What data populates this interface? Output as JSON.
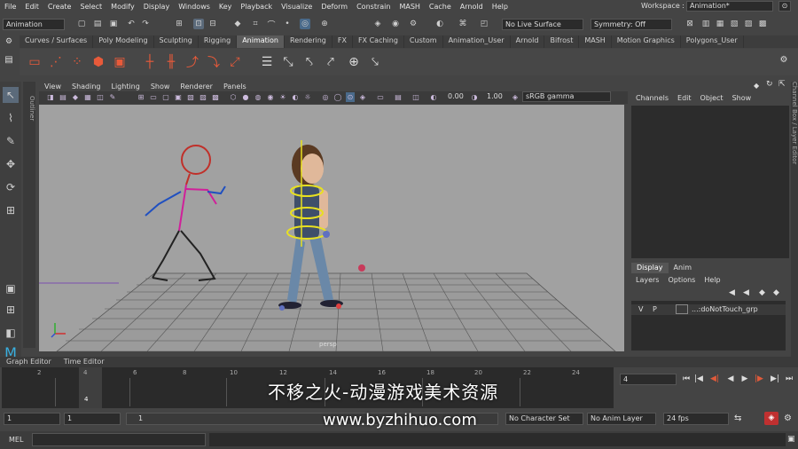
{
  "menubar": {
    "items": [
      "File",
      "Edit",
      "Create",
      "Select",
      "Modify",
      "Display",
      "Windows",
      "Key",
      "Playback",
      "Visualize",
      "Deform",
      "Constrain",
      "MASH",
      "Cache",
      "Arnold",
      "Help"
    ],
    "workspace_label": "Workspace :",
    "workspace_value": "Animation*"
  },
  "statusline": {
    "mode": "Animation",
    "live_surface": "No Live Surface",
    "symmetry": "Symmetry: Off"
  },
  "shelf_tabs": [
    "Curves / Surfaces",
    "Poly Modeling",
    "Sculpting",
    "Rigging",
    "Animation",
    "Rendering",
    "FX",
    "FX Caching",
    "Custom",
    "Animation_User",
    "Arnold",
    "Bifrost",
    "MASH",
    "Motion Graphics",
    "Polygons_User"
  ],
  "active_shelf_tab": "Animation",
  "outliner_label": "Outliner",
  "panel_menu": [
    "View",
    "Shading",
    "Lighting",
    "Show",
    "Renderer",
    "Panels"
  ],
  "panel_toolbar": {
    "exposure": "0.00",
    "gamma": "1.00",
    "color_space": "sRGB gamma"
  },
  "viewport": {
    "camera_label": "persp"
  },
  "channel_box": {
    "menu": [
      "Channels",
      "Edit",
      "Object",
      "Show"
    ],
    "side_tab": "Channel Box / Layer Editor"
  },
  "layer_editor": {
    "tabs": [
      "Display",
      "Anim"
    ],
    "active_tab": "Display",
    "menu": [
      "Layers",
      "Options",
      "Help"
    ],
    "layers": [
      {
        "v": "V",
        "p": "P",
        "name": "...:doNotTouch_grp"
      }
    ]
  },
  "time_tabs": [
    "Graph Editor",
    "Time Editor"
  ],
  "timeline": {
    "ticks": [
      "2",
      "4",
      "6",
      "8",
      "10",
      "12",
      "14",
      "16",
      "18",
      "20",
      "22",
      "24"
    ],
    "playhead_frame": "4",
    "current_frame": "4"
  },
  "range": {
    "start": "1",
    "playback_start": "1",
    "range_label": "1",
    "character_set": "No Character Set",
    "anim_layer": "No Anim Layer",
    "fps": "24 fps"
  },
  "mel": {
    "label": "MEL"
  },
  "watermark": {
    "line1": "不移之火-动漫游戏美术资源",
    "line2": "www.byzhihuo.com"
  }
}
